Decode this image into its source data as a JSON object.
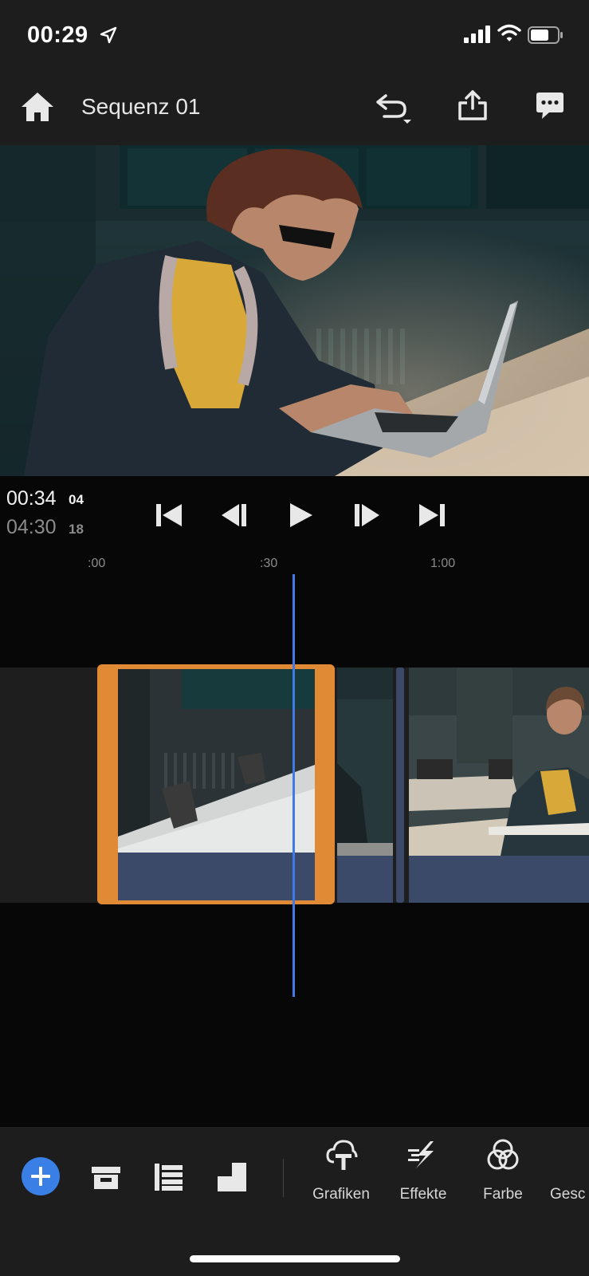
{
  "status": {
    "time": "00:29"
  },
  "header": {
    "title": "Sequenz 01"
  },
  "transport": {
    "current_time": "00:34",
    "current_frames": "04",
    "total_time": "04:30",
    "total_frames": "18"
  },
  "ruler": {
    "labels": [
      ":00",
      ":30",
      "1:00"
    ]
  },
  "toolbar": {
    "tools": [
      {
        "label": "Grafiken",
        "icon": "graphics-icon"
      },
      {
        "label": "Effekte",
        "icon": "effects-icon"
      },
      {
        "label": "Farbe",
        "icon": "color-icon"
      },
      {
        "label": "Gesc",
        "icon": "speed-icon"
      }
    ]
  },
  "colors": {
    "accent": "#3a7fe6",
    "selection": "#e08a35",
    "audio_track": "#3a4a68",
    "background": "#1d1d1d"
  }
}
